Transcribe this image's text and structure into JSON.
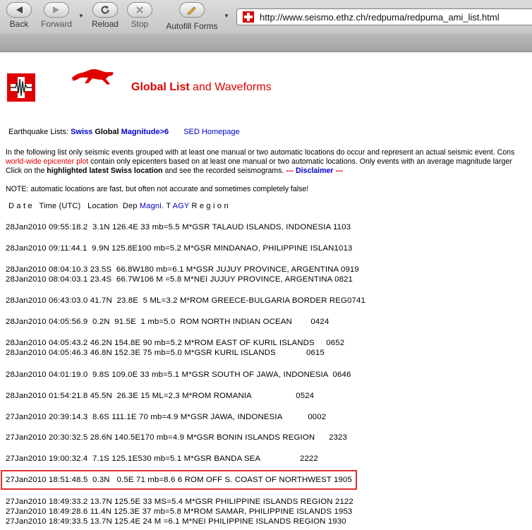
{
  "toolbar": {
    "back_label": "Back",
    "forward_label": "Forward",
    "reload_label": "Reload",
    "stop_label": "Stop",
    "autofill_label": "Autofill Forms",
    "url": "http://www.seismo.ethz.ch/redpuma/redpuma_ami_list.html"
  },
  "header": {
    "title_bold": "Global List",
    "title_rest": " and Waveforms"
  },
  "nav": {
    "prefix": "Earthquake Lists: ",
    "swiss": "Swiss",
    "global": "Global",
    "magnitude": "Magnitude>6",
    "sed": "SED Homepage"
  },
  "intro": {
    "line1": "In the following list only seismic events grouped with at least one manual or two automatic locations do occur and represent an actual seismic event. Cons",
    "line2_link": "world-wide epicenter plot",
    "line2_rest": " contain only epicenters based on at least one manual or two automatic locations. Only events with an average magnitude larger",
    "line3_a": "Click on the ",
    "line3_bold": "highlighted latest Swiss location",
    "line3_b": " and see the recorded seismograms.   ",
    "line3_disc_dash1": "--- ",
    "line3_disc": "Disclaimer",
    "line3_disc_dash2": " ---",
    "note": "NOTE: automatic locations are fast, but often not accurate and sometimes completely false!"
  },
  "columns": {
    "part1": "D a t e   Time (UTC)   Location  Dep ",
    "magni": "Magni",
    "part2": ". T ",
    "agy": "AGY",
    "part3": " R e g i o n"
  },
  "events": [
    "28Jan2010 09:55:18.2  3.1N 126.4E 33 mb=5.5 M*GSR TALAUD ISLANDS, INDONESIA 1103",
    "28Jan2010 09:11:44.1  9.9N 125.8E100 mb=5.2 M*GSR MINDANAO, PHILIPPINE ISLAN1013",
    "28Jan2010 08:04:10.3 23.5S  66.8W180 mb=6.1 M*GSR JUJUY PROVINCE, ARGENTINA 0919",
    "28Jan2010 08:04:03.1 23.4S  66.7W106 M =5.8 M*NEI JUJUY PROVINCE, ARGENTINA 0821",
    "28Jan2010 06:43:03.0 41.7N  23.8E  5 ML=3.2 M*ROM GREECE-BULGARIA BORDER REG0741",
    "28Jan2010 04:05:56.9  0.2N  91.5E  1 mb=5.0  ROM NORTH INDIAN OCEAN        0424",
    "28Jan2010 04:05:43.2 46.2N 154.8E 90 mb=5.2 M*ROM EAST OF KURIL ISLANDS     0652",
    "28Jan2010 04:05:46.3 46.8N 152.3E 75 mb=5.0 M*GSR KURIL ISLANDS             0615",
    "28Jan2010 04:01:19.0  9.8S 109.0E 33 mb=5.1 M*GSR SOUTH OF JAWA, INDONESIA  0646",
    "28Jan2010 01:54:21.8 45.5N  26.3E 15 ML=2.3 M*ROM ROMANIA                   0524",
    "27Jan2010 20:39:14.3  8.6S 111.1E 70 mb=4.9 M*GSR JAWA, INDONESIA           0002",
    "27Jan2010 20:30:32.5 28.6N 140.5E170 mb=4.9 M*GSR BONIN ISLANDS REGION      2323",
    "27Jan2010 19:00:32.4  7.1S 125.1E530 mb=5.1 M*GSR BANDA SEA                 2222",
    "27Jan2010 18:51:48.5  0.3N   0.5E 71 mb=8.6 6 ROM OFF S. COAST OF NORTHWEST 1905",
    "27Jan2010 18:49:33.2 13.7N 125.5E 33 MS=5.4 M*GSR PHILIPPINE ISLANDS REGION 2122",
    "27Jan2010 18:49:28.6 11.4N 125.3E 37 mb=5.8 M*ROM SAMAR, PHILIPPINE ISLANDS 1953",
    "27Jan2010 18:49:33.5 13.7N 125.4E 24 M =6.1 M*NEI PHILIPPINE ISLANDS REGION 1930"
  ],
  "highlighted_event_index": 13,
  "colors": {
    "accent_red": "#e00000",
    "link_blue": "#0000cc",
    "highlight_box": "#e03030"
  }
}
